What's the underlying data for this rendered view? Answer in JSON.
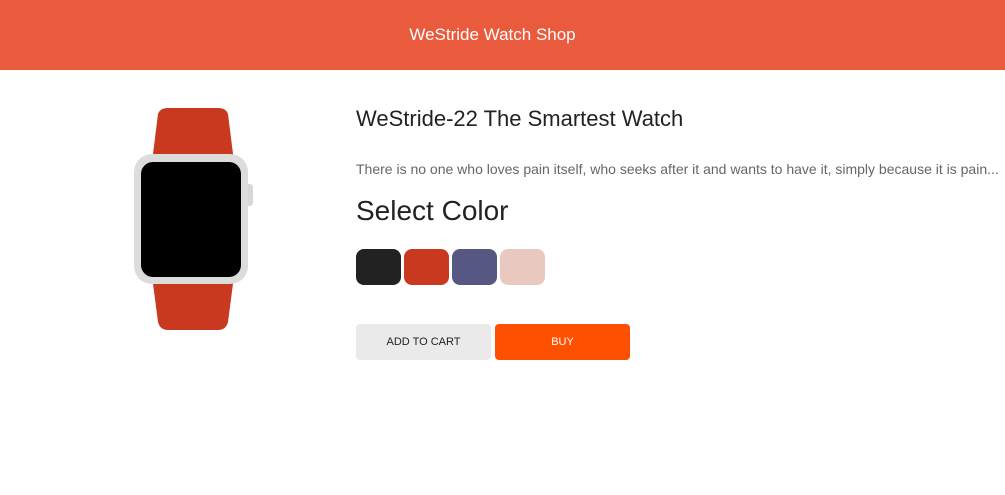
{
  "header": {
    "title": "WeStride Watch Shop",
    "background": "#ea5b3d"
  },
  "product": {
    "image_icon": "red-smartwatch-image",
    "title": "WeStride-22 The Smartest Watch",
    "description": "There is no one who loves pain itself, who seeks after it and wants to have it, simply because it is pain..."
  },
  "color_selector": {
    "heading": "Select Color",
    "swatches": [
      {
        "name": "black",
        "color": "#222222"
      },
      {
        "name": "red",
        "color": "#c9391f"
      },
      {
        "name": "purple",
        "color": "#575783"
      },
      {
        "name": "pink",
        "color": "#e9c8c0"
      }
    ]
  },
  "actions": {
    "add_to_cart_label": "ADD TO CART",
    "buy_label": "BUY",
    "buy_color": "#ff4f00"
  }
}
